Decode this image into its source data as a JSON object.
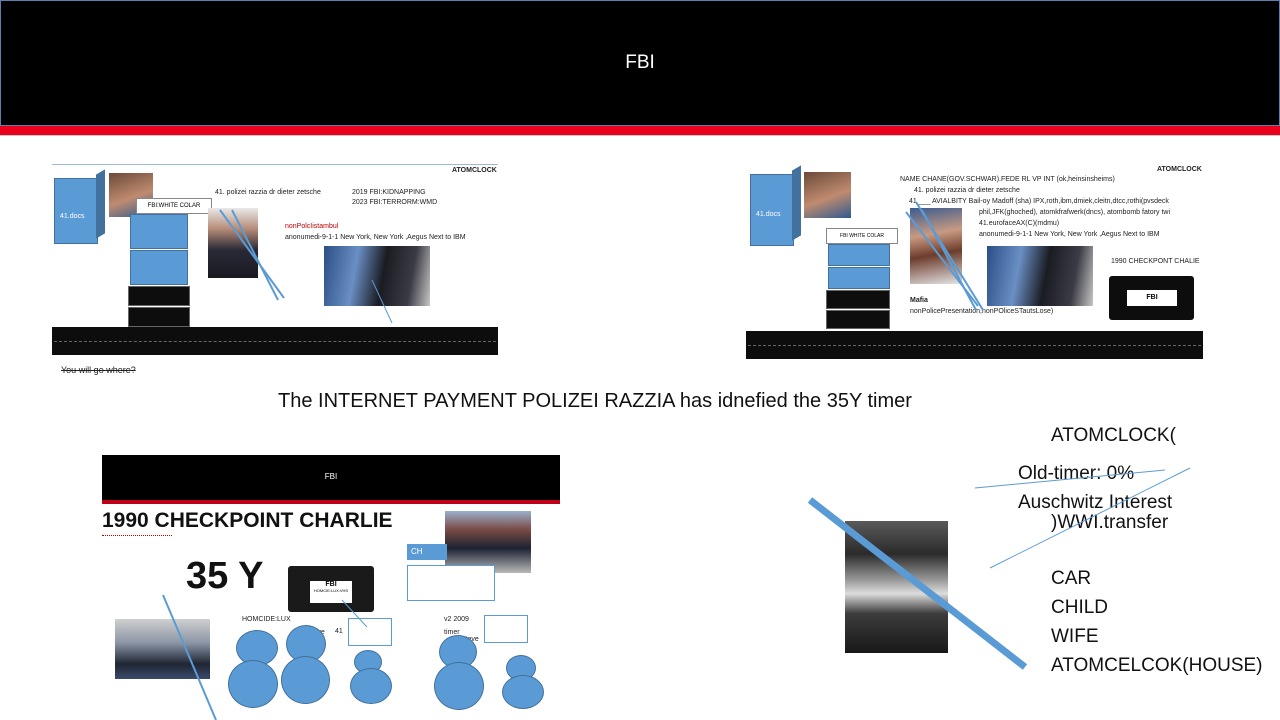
{
  "header": {
    "title": "FBI"
  },
  "slide_top_left": {
    "atomclock": "ATOMCLOCK",
    "docs": "41.docs",
    "white_colar": "FBI:WHITE COLAR",
    "line1": "41. polizei razzia dr dieter zetsche",
    "line2": "2019 FBI:KIDNAPPING",
    "line3": "2023 FBI:TERRORM:WMD",
    "line4": "nonPolcIistambul",
    "line5": "anonumedi-9-1-1 New York, New York ,Aegus Next to IBM"
  },
  "caption_where": "You will go where?",
  "slide_top_right": {
    "atomclock": "ATOMCLOCK",
    "docs": "41.docs",
    "name_line": "NAME CHANE(GOV.SCHWAR).FEDE RL VP INT (ok,heinsinsheims)",
    "line1": "41. polizei razzia dr dieter zetsche",
    "line2": "41 ___ AVIALBITY  Bail-oy Madoff (sha) IPX,roth,ibm,dmiek,cleitn,dtcc,rothi(pvsdeck",
    "line3": "phil,JFK(ghoched), atomkfrafwerk(dncs), atombomb fatory twi",
    "line4": "41.eurofaceAX(C)(mdmu)",
    "line5": "anonumedi-9-1-1 New York, New York ,Aegus Next to IBM",
    "checkpoint": "1990 CHECKPONT CHALIE",
    "white_colar": "FBI WHITE COLAR",
    "mafia": "Mafia",
    "mafia_line": "nonPolicePresentation,nonPOliceSTautsLose)",
    "vhs": "FBI"
  },
  "main_text": "The INTERNET PAYMENT POLIZEI RAZZIA has idnefied the 35Y timer",
  "slide_bottom": {
    "header_title": "FBI",
    "title": "1990 CHECKPOINT CHARLIE",
    "big": "35 Y",
    "vhs_fbi": "FBI",
    "vhs_sub": "HOMCIE:LUX:VHS",
    "homcide": "HOMCIDE:LUX",
    "steve1": "steve",
    "num1": "41",
    "v2": "v2 2009",
    "timer": "timer",
    "steve2": "steve",
    "num2": "41",
    "ch": "CH"
  },
  "right_text": {
    "atomclock": "ATOMCLOCK(",
    "oldtimer": "Old-timer: 0%",
    "auschwitz": "Auschwitz Interest",
    "wwi": ")WWI.transfer",
    "list": [
      "CAR",
      "CHILD",
      "WIFE",
      "ATOMCELCOK(HOUSE)"
    ]
  },
  "colors": {
    "accent_blue": "#5b9bd5",
    "red": "#e8001c",
    "black": "#000000"
  }
}
